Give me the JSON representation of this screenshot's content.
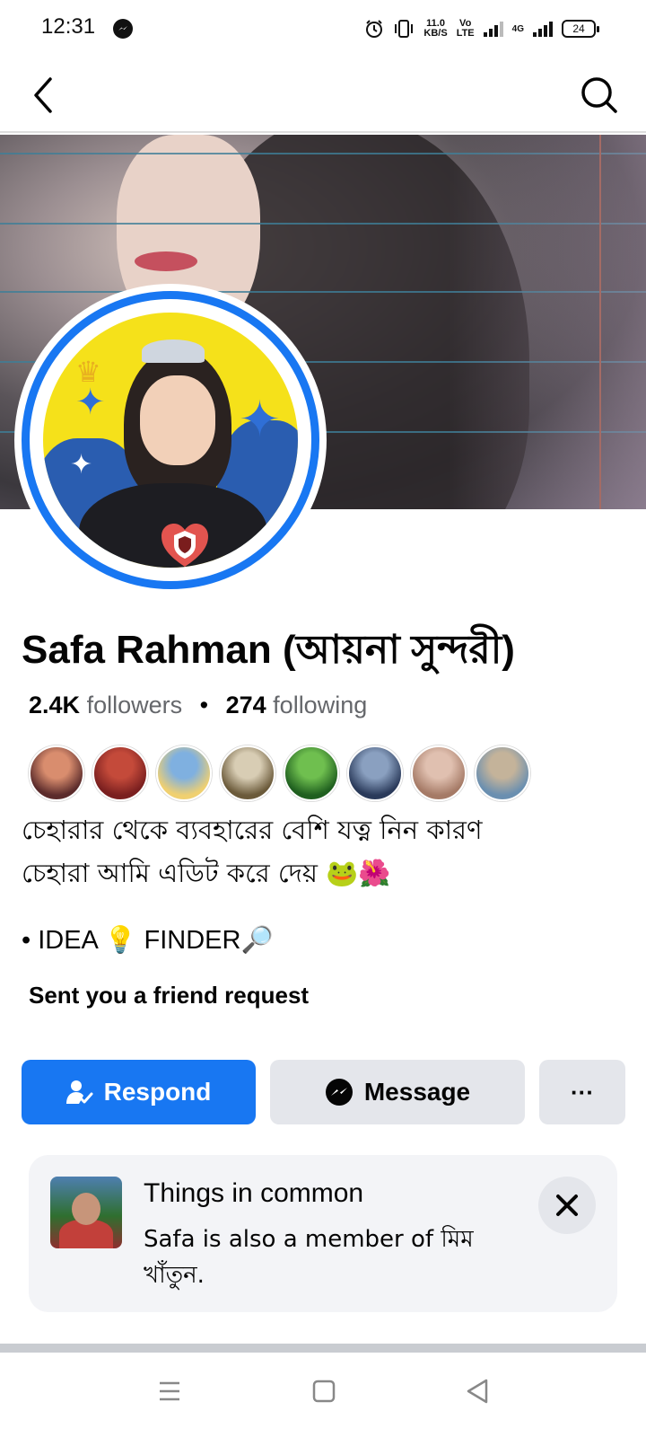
{
  "status_bar": {
    "time": "12:31",
    "net_speed_value": "11.0",
    "net_speed_unit": "KB/S",
    "volte_top": "Vo",
    "volte_bottom": "LTE",
    "network_type": "4G",
    "battery": "24"
  },
  "profile": {
    "name": "Safa Rahman (আয়না সুন্দরী)",
    "followers_count": "2.4K",
    "followers_label": "followers",
    "following_count": "274",
    "following_label": "following",
    "bio_line1": "চেহারার থেকে ব্যবহারের বেশি যত্ন নিন কারণ",
    "bio_line2": "চেহারা আমি এডিট করে দেয় 🐸🌺",
    "tagline": "• IDEA 💡 FINDER🔎",
    "friend_request_text": "Sent you a friend request"
  },
  "friend_avatars": [
    {
      "color_a": "#5b2b2b",
      "color_b": "#d98d6e"
    },
    {
      "color_a": "#7a1f1f",
      "color_b": "#c44a3a"
    },
    {
      "color_a": "#f0d070",
      "color_b": "#7fb0e0"
    },
    {
      "color_a": "#6b5a3a",
      "color_b": "#d8cdb4"
    },
    {
      "color_a": "#1f5f1f",
      "color_b": "#6fbf4f"
    },
    {
      "color_a": "#2a3a5a",
      "color_b": "#8aa0c0"
    },
    {
      "color_a": "#a57a66",
      "color_b": "#e0c0b0"
    },
    {
      "color_a": "#6a8fb0",
      "color_b": "#c4b39a"
    }
  ],
  "actions": {
    "respond_label": "Respond",
    "message_label": "Message",
    "more_label": "···"
  },
  "common": {
    "title": "Things in common",
    "text": "Safa is also a member of মিম খাঁতুন."
  },
  "colors": {
    "accent": "#1877f2",
    "secondary_button": "#e4e6eb",
    "muted_text": "#65676b"
  }
}
